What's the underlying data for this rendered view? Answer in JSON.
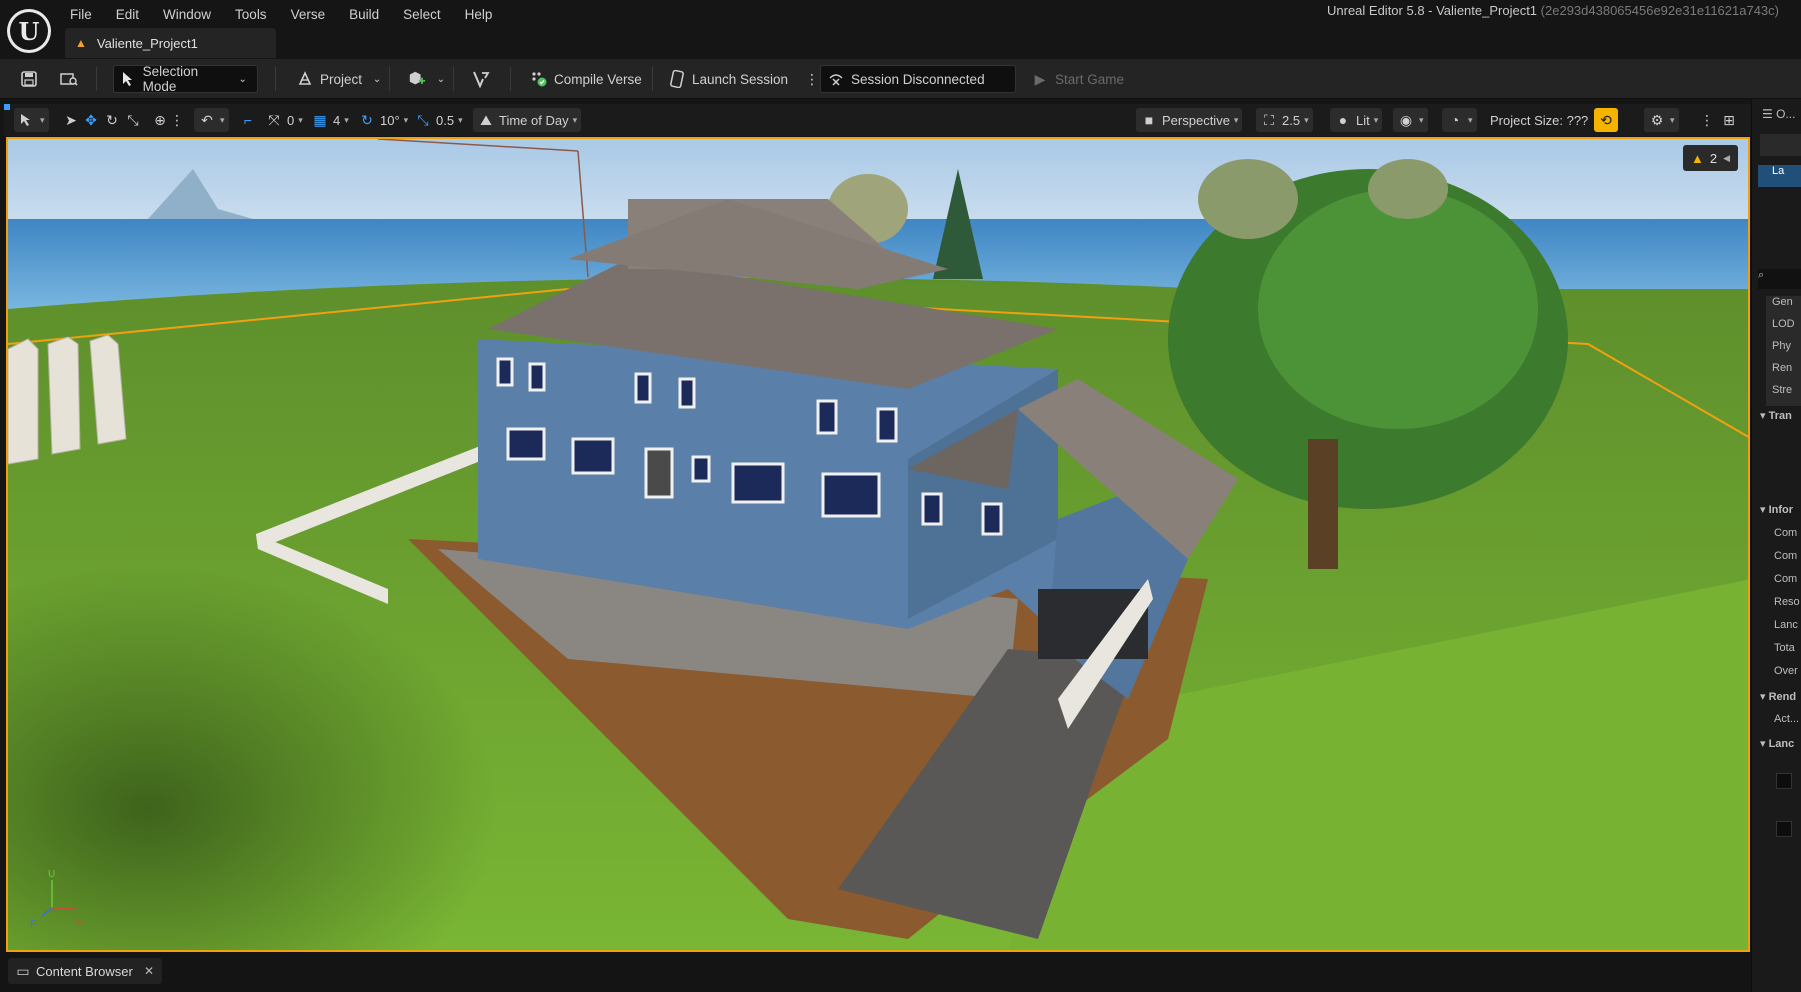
{
  "window": {
    "title": "Unreal Editor 5.8 - Valiente_Project1",
    "hash": "(2e293d438065456e92e31e11621a743c)",
    "project_tab": "Valiente_Project1"
  },
  "menu": [
    "File",
    "Edit",
    "Window",
    "Tools",
    "Verse",
    "Build",
    "Select",
    "Help"
  ],
  "toolbar": {
    "selection_mode": "Selection Mode",
    "project": "Project",
    "compile_verse": "Compile Verse",
    "launch_session": "Launch Session",
    "session_status": "Session Disconnected",
    "start_game": "Start Game"
  },
  "viewport_toolbar": {
    "snap_translate": "0",
    "grid": "4",
    "rotate_snap": "10°",
    "scale_snap": "0.5",
    "time_of_day": "Time of Day",
    "perspective": "Perspective",
    "camera_speed": "2.5",
    "lit": "Lit",
    "project_size": "Project Size: ???"
  },
  "viewport": {
    "warning_count": "2",
    "axis_labels": {
      "up": "U",
      "right": "L",
      "forward": "F"
    }
  },
  "right_panel": {
    "tab": "O...",
    "rows": [
      "La",
      "Gen",
      "LOD",
      "Phy",
      "Ren",
      "Stre",
      "Tran",
      "Infor",
      "Com",
      "Com",
      "Com",
      "Reso",
      "Lanc",
      "Tota",
      "Over",
      "Rend",
      "Act...",
      "Lanc"
    ]
  },
  "bottom": {
    "content_browser": "Content Browser"
  },
  "colors": {
    "selection_outline": "#f0a010",
    "accent_orange": "#f0a030",
    "play_yellow": "#f5b400"
  }
}
